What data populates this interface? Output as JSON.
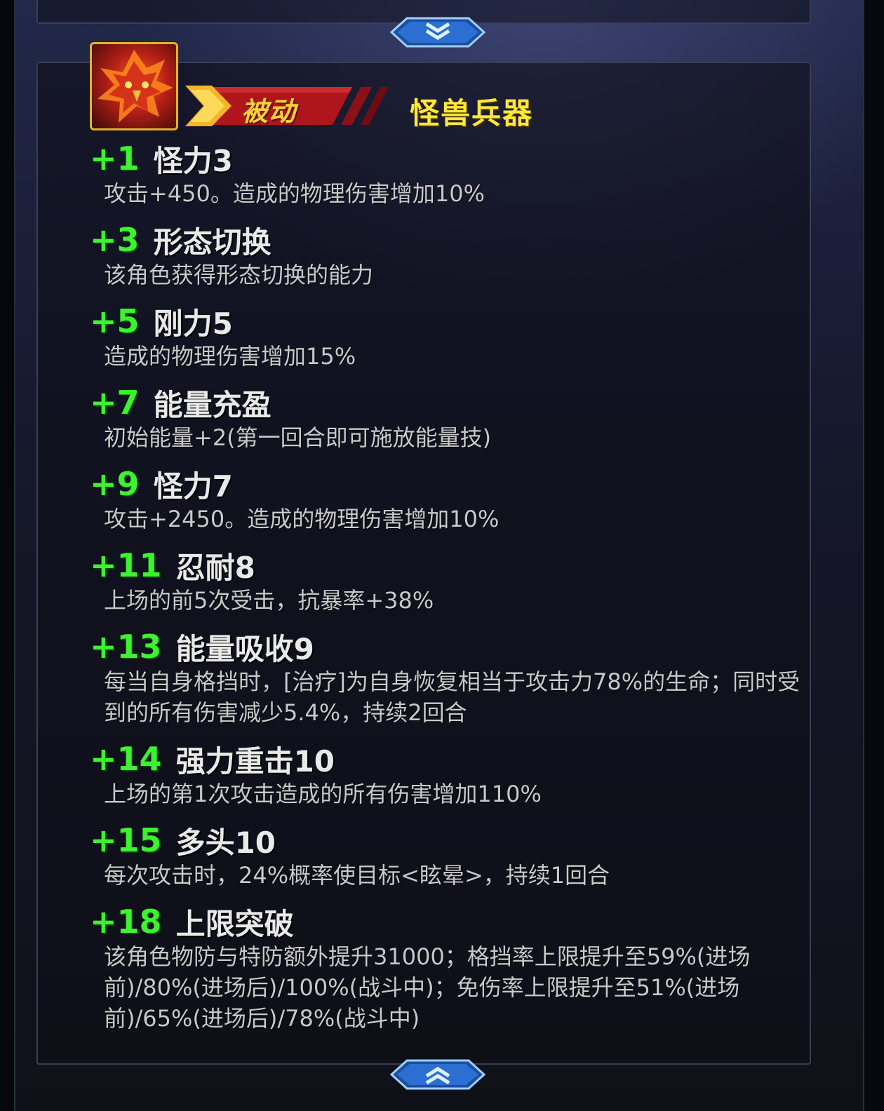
{
  "header": {
    "passive_label": "被动",
    "weapon_title": "怪兽兵器"
  },
  "icons": {
    "scroll_up": "double-chevron-down-icon",
    "scroll_down": "double-chevron-up-icon",
    "avatar": "phoenix-hero-avatar"
  },
  "colors": {
    "level": "#3df22f",
    "title": "#ffe83a",
    "banner": "#b0141c"
  },
  "skills": [
    {
      "level": "+1",
      "name": "怪力3",
      "desc": "攻击+450。造成的物理伤害增加10%"
    },
    {
      "level": "+3",
      "name": "形态切换",
      "desc": "该角色获得形态切换的能力"
    },
    {
      "level": "+5",
      "name": "刚力5",
      "desc": "造成的物理伤害增加15%"
    },
    {
      "level": "+7",
      "name": "能量充盈",
      "desc": "初始能量+2(第一回合即可施放能量技)"
    },
    {
      "level": "+9",
      "name": "怪力7",
      "desc": "攻击+2450。造成的物理伤害增加10%"
    },
    {
      "level": "+11",
      "name": "忍耐8",
      "desc": "上场的前5次受击，抗暴率+38%"
    },
    {
      "level": "+13",
      "name": "能量吸收9",
      "desc": "每当自身格挡时，[治疗]为自身恢复相当于攻击力78%的生命；同时受到的所有伤害减少5.4%，持续2回合"
    },
    {
      "level": "+14",
      "name": "强力重击10",
      "desc": "上场的第1次攻击造成的所有伤害增加110%"
    },
    {
      "level": "+15",
      "name": "多头10",
      "desc": "每次攻击时，24%概率使目标<眩晕>，持续1回合"
    },
    {
      "level": "+18",
      "name": "上限突破",
      "desc": "该角色物防与特防额外提升31000；格挡率上限提升至59%(进场前)/80%(进场后)/100%(战斗中)；免伤率上限提升至51%(进场前)/65%(进场后)/78%(战斗中)"
    }
  ]
}
